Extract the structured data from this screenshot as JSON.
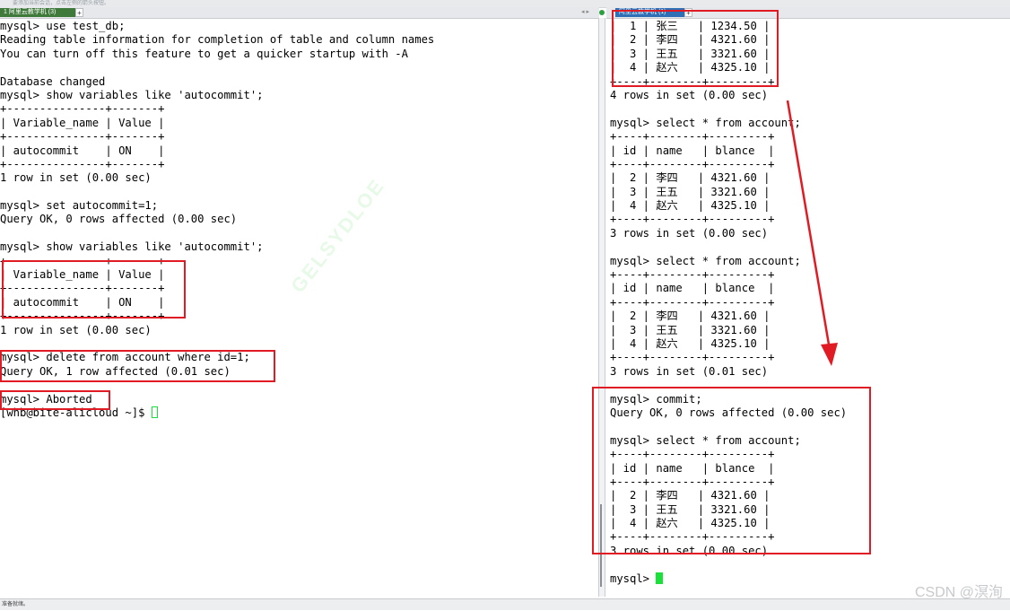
{
  "topbar": {
    "hint": "要添加当前会话，点击左侧的箭头按钮。"
  },
  "tabs": {
    "left_label": "1 阿里云教学机 (3)",
    "right_label": "阿里云教学机 (1)",
    "add_glyph": "+",
    "nav_glyph": "◂ ▸"
  },
  "left_terminal": {
    "lines": [
      "mysql> use test_db;",
      "Reading table information for completion of table and column names",
      "You can turn off this feature to get a quicker startup with -A",
      "",
      "Database changed",
      "mysql> show variables like 'autocommit';",
      "+---------------+-------+",
      "| Variable_name | Value |",
      "+---------------+-------+",
      "| autocommit    | ON    |",
      "+---------------+-------+",
      "1 row in set (0.00 sec)",
      "",
      "mysql> set autocommit=1;",
      "Query OK, 0 rows affected (0.00 sec)",
      "",
      "mysql> show variables like 'autocommit';",
      "+---------------+-------+",
      "| Variable_name | Value |",
      "+---------------+-------+",
      "| autocommit    | ON    |",
      "+---------------+-------+",
      "1 row in set (0.00 sec)",
      "",
      "mysql> delete from account where id=1;",
      "Query OK, 1 row affected (0.01 sec)",
      "",
      "mysql> Aborted"
    ],
    "prompt": "[whb@bite-alicloud ~]$ "
  },
  "right_terminal": {
    "lines": [
      "|  1 | 张三   | 1234.50 |",
      "|  2 | 李四   | 4321.60 |",
      "|  3 | 王五   | 3321.60 |",
      "|  4 | 赵六   | 4325.10 |",
      "+----+--------+---------+",
      "4 rows in set (0.00 sec)",
      "",
      "mysql> select * from account;",
      "+----+--------+---------+",
      "| id | name   | blance  |",
      "+----+--------+---------+",
      "|  2 | 李四   | 4321.60 |",
      "|  3 | 王五   | 3321.60 |",
      "|  4 | 赵六   | 4325.10 |",
      "+----+--------+---------+",
      "3 rows in set (0.00 sec)",
      "",
      "mysql> select * from account;",
      "+----+--------+---------+",
      "| id | name   | blance  |",
      "+----+--------+---------+",
      "|  2 | 李四   | 4321.60 |",
      "|  3 | 王五   | 3321.60 |",
      "|  4 | 赵六   | 4325.10 |",
      "+----+--------+---------+",
      "3 rows in set (0.01 sec)",
      "",
      "mysql> commit;",
      "Query OK, 0 rows affected (0.00 sec)",
      "",
      "mysql> select * from account;",
      "+----+--------+---------+",
      "| id | name   | blance  |",
      "+----+--------+---------+",
      "|  2 | 李四   | 4321.60 |",
      "|  3 | 王五   | 3321.60 |",
      "|  4 | 赵六   | 4325.10 |",
      "+----+--------+---------+",
      "3 rows in set (0.00 sec)",
      ""
    ],
    "prompt": "mysql> "
  },
  "watermark": "GELSYDLOE",
  "credit": "CSDN @溟洵",
  "statusbar": {
    "text": "准备就绪。"
  },
  "colors": {
    "annotation": "#e01b24",
    "cursor": "#18e23a"
  }
}
